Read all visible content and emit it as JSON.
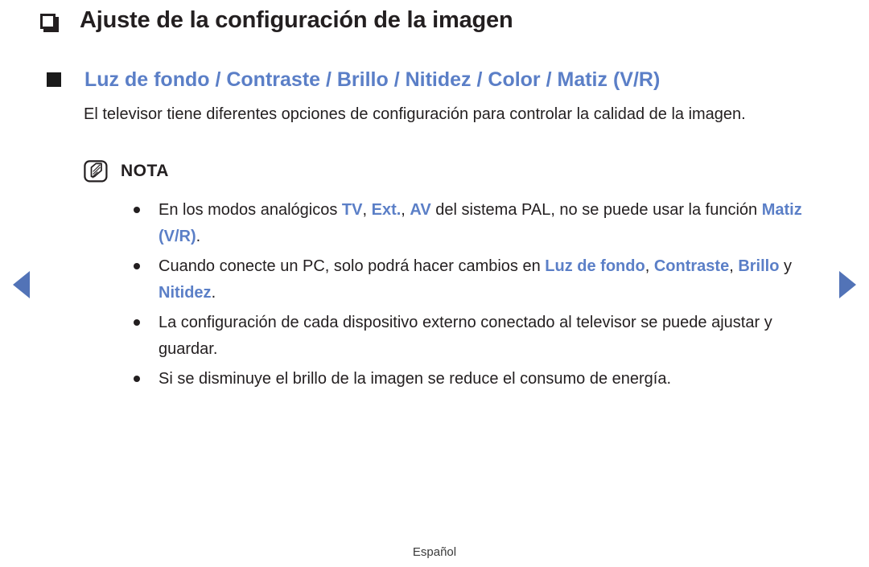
{
  "page": {
    "title": "Ajuste de la configuración de la imagen",
    "title_bullet_icon": "hollow-square-bullet-icon",
    "subtitle": "Luz de fondo / Contraste / Brillo / Nitidez / Color / Matiz (V/R)",
    "subtitle_bullet_icon": "filled-square-bullet-icon",
    "intro": "El televisor tiene diferentes opciones de configuración para controlar la calidad de la imagen.",
    "footer": "Español"
  },
  "note": {
    "icon": "note-pencil-icon",
    "label": "NOTA",
    "items": [
      {
        "segments": [
          {
            "text": "En los modos analógicos ",
            "highlight": false
          },
          {
            "text": "TV",
            "highlight": true
          },
          {
            "text": ", ",
            "highlight": false
          },
          {
            "text": "Ext.",
            "highlight": true
          },
          {
            "text": ", ",
            "highlight": false
          },
          {
            "text": "AV",
            "highlight": true
          },
          {
            "text": " del sistema PAL, no se puede usar la función ",
            "highlight": false
          },
          {
            "text": "Matiz (V/R)",
            "highlight": true
          },
          {
            "text": ".",
            "highlight": false
          }
        ]
      },
      {
        "segments": [
          {
            "text": "Cuando conecte un PC, solo podrá hacer cambios en ",
            "highlight": false
          },
          {
            "text": "Luz de fondo",
            "highlight": true
          },
          {
            "text": ", ",
            "highlight": false
          },
          {
            "text": "Contraste",
            "highlight": true
          },
          {
            "text": ", ",
            "highlight": false
          },
          {
            "text": "Brillo",
            "highlight": true
          },
          {
            "text": " y ",
            "highlight": false
          },
          {
            "text": "Nitidez",
            "highlight": true
          },
          {
            "text": ".",
            "highlight": false
          }
        ]
      },
      {
        "segments": [
          {
            "text": "La configuración de cada dispositivo externo conectado al televisor se puede ajustar y guardar.",
            "highlight": false
          }
        ]
      },
      {
        "segments": [
          {
            "text": "Si se disminuye el brillo de la imagen se reduce el consumo de energía.",
            "highlight": false
          }
        ]
      }
    ]
  },
  "nav": {
    "prev_icon": "left-triangle-arrow-icon",
    "next_icon": "right-triangle-arrow-icon"
  },
  "colors": {
    "accent_blue": "#5b7fc7",
    "arrow_blue": "#5273b7",
    "text_dark": "#231f20",
    "background": "#ffffff"
  }
}
